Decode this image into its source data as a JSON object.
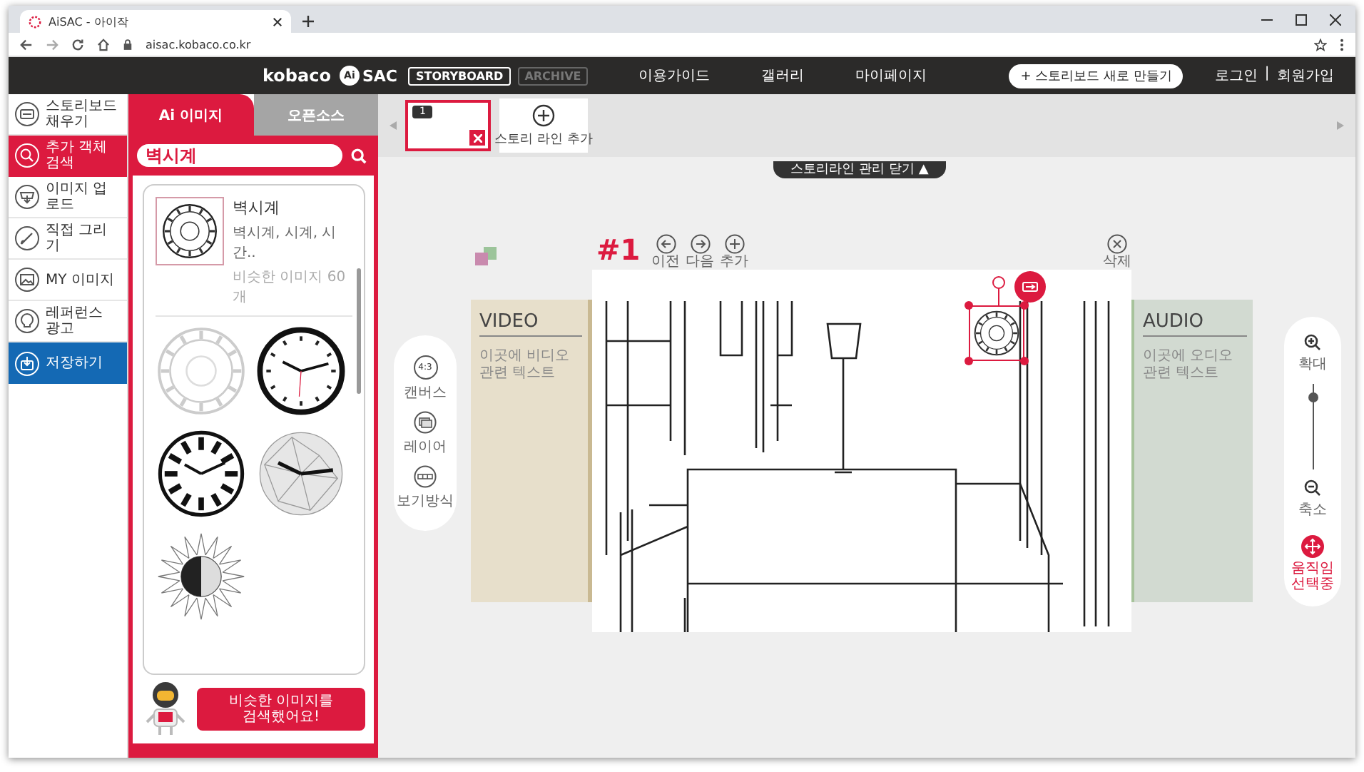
{
  "browser": {
    "tab_title": "AiSAC - 아이작",
    "url": "aisac.kobaco.co.kr"
  },
  "header": {
    "brand": "kobaco",
    "logo_badge": "Ai",
    "logo": "SAC",
    "modes": [
      {
        "label": "STORYBOARD",
        "selected": true
      },
      {
        "label": "ARCHIVE",
        "selected": false
      }
    ],
    "nav": [
      "이용가이드",
      "갤러리",
      "마이페이지"
    ],
    "new_button": "+ 스토리보드 새로 만들기",
    "login": "로그인",
    "separator": "|",
    "signup": "회원가입"
  },
  "sidebar": {
    "items": [
      {
        "kind": "storyboard",
        "label": "스토리보드 채우기",
        "selected": false
      },
      {
        "kind": "search",
        "label": "추가 객체 검색",
        "selected": true
      },
      {
        "kind": "upload",
        "label": "이미지 업로드",
        "selected": false
      },
      {
        "kind": "draw",
        "label": "직접 그리기",
        "selected": false
      },
      {
        "kind": "gallery",
        "label": "MY 이미지",
        "selected": false
      },
      {
        "kind": "reference",
        "label": "레퍼런스 광고",
        "selected": false
      }
    ],
    "save_button": "저장하기"
  },
  "image_panel": {
    "tabs": [
      {
        "label": "Ai 이미지",
        "selected": true
      },
      {
        "label": "오픈소스",
        "selected": false
      }
    ],
    "search": {
      "value": "벽시계"
    },
    "top_result": {
      "title": "벽시계",
      "tags": "벽시계, 시계, 시간..",
      "count": "비슷한 이미지 60개"
    },
    "results": [
      {
        "kind": "roman"
      },
      {
        "kind": "classic"
      },
      {
        "kind": "bold"
      },
      {
        "kind": "geometric"
      },
      {
        "kind": "sunburst"
      }
    ],
    "assistant_message": "비슷한 이미지를 검색했어요!"
  },
  "storyline": {
    "scenes": [
      {
        "number": "1",
        "selected": true
      }
    ],
    "add_label": "스토리 라인 추가",
    "toggle": "스토리라인 관리 닫기 ▲"
  },
  "tools": [
    {
      "kind": "ratio",
      "badge": "4:3",
      "label": "캔버스"
    },
    {
      "kind": "layers",
      "label": "레이어"
    },
    {
      "kind": "view",
      "label": "보기방식"
    }
  ],
  "scene": {
    "number": "#1",
    "nav": [
      {
        "kind": "prev",
        "label": "이전"
      },
      {
        "kind": "next",
        "label": "다음"
      },
      {
        "kind": "add",
        "label": "추가"
      }
    ],
    "delete_label": "삭제",
    "video": {
      "title": "VIDEO",
      "text": "이곳에 비디오 관련 텍스트"
    },
    "audio": {
      "title": "AUDIO",
      "text": "이곳에 오디오 관련 텍스트"
    }
  },
  "zoom": {
    "in_label": "확대",
    "level": 0.85,
    "out_label": "축소",
    "move_label": "움직임 선택중"
  }
}
